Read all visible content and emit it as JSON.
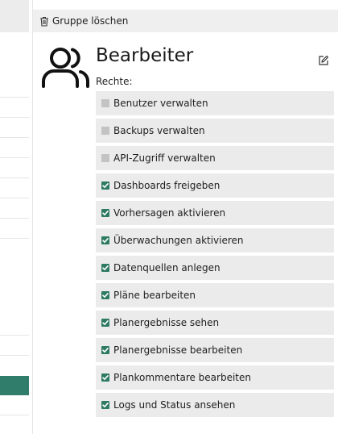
{
  "toolbar": {
    "delete_label": "Gruppe löschen",
    "delete_icon": "trash-icon"
  },
  "group": {
    "title": "Bearbeiter",
    "icon": "users-icon",
    "edit_icon": "edit-icon"
  },
  "rights_label": "Rechte:",
  "permissions": [
    {
      "label": "Benutzer verwalten",
      "checked": false
    },
    {
      "label": "Backups verwalten",
      "checked": false
    },
    {
      "label": "API-Zugriff verwalten",
      "checked": false
    },
    {
      "label": "Dashboards freigeben",
      "checked": true
    },
    {
      "label": "Vorhersagen aktivieren",
      "checked": true
    },
    {
      "label": "Überwachungen aktivieren",
      "checked": true
    },
    {
      "label": "Datenquellen anlegen",
      "checked": true
    },
    {
      "label": "Pläne bearbeiten",
      "checked": true
    },
    {
      "label": "Planergebnisse sehen",
      "checked": true
    },
    {
      "label": "Planergebnisse bearbeiten",
      "checked": true
    },
    {
      "label": "Plankommentare bearbeiten",
      "checked": true
    },
    {
      "label": "Logs und Status ansehen",
      "checked": true
    }
  ],
  "colors": {
    "accent": "#2e7a63",
    "item_bg": "#ebebeb",
    "toolbar_bg": "#efefef",
    "unchecked_box": "#c3c3c3"
  }
}
